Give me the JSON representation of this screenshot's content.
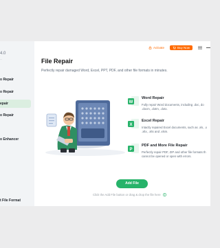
{
  "sidebar": {
    "logo_text": "4.0",
    "logo_sub": "...",
    "items": [
      {
        "label": "o Repair"
      },
      {
        "label": "o Repair"
      },
      {
        "label": "epair"
      },
      {
        "label": "o Repair"
      },
      {
        "label": "o Enhancer"
      }
    ],
    "footer": "t File Format"
  },
  "topbar": {
    "activate_label": "Activate",
    "buy_label": "Buy Now"
  },
  "main": {
    "title": "File Repair",
    "subtitle": "Perfectly repair damaged Word, Excel, PPT, PDF, and other file formats in minutes.",
    "features": [
      {
        "name": "Word Repair",
        "desc1": "Fully repair Word documents, including .doc, do",
        "desc2": ".docm, .dotm, .dotx."
      },
      {
        "name": "Excel Repair",
        "desc1": "Intactly repaired Excel documents, such as .xls, .x",
        "desc2": ".xltx, .xlts and .xlsm."
      },
      {
        "name": "PDF and More File Repair",
        "desc1": "Perfectly repair PDF, ZIP and other file formats th",
        "desc2": "cannot be opened or open with errors."
      }
    ],
    "add_button": "Add File",
    "hint": "Click the Add File button or drag & drop the file here"
  },
  "colors": {
    "accent": "#27b36a",
    "buy": "#ff6a00"
  }
}
